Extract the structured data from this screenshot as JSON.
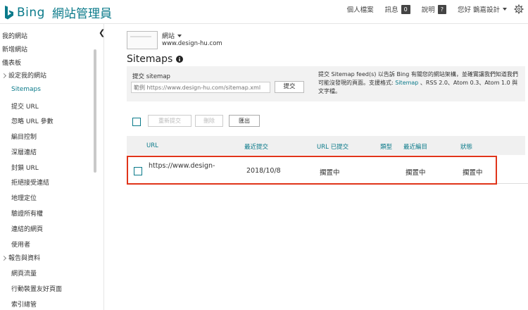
{
  "brand": {
    "name": "Bing",
    "product": "網站管理員",
    "color": "#0a7a8a"
  },
  "top_links": [
    {
      "label": "個人檔案"
    },
    {
      "label": "訊息",
      "badge": "0"
    },
    {
      "label": "說明",
      "badge": "?"
    },
    {
      "label": "您好 鵲嘉設計"
    }
  ],
  "sidebar": {
    "items": [
      {
        "label": "我的網站"
      },
      {
        "label": "新增網站"
      },
      {
        "label": "儀表板"
      },
      {
        "label": "設定我的網站",
        "expandable": true
      },
      {
        "label": "Sitemaps",
        "active": true
      },
      {
        "label": "提交 URL"
      },
      {
        "label": "忽略 URL 參數"
      },
      {
        "label": "編目控制"
      },
      {
        "label": "深層連結"
      },
      {
        "label": "封鎖 URL"
      },
      {
        "label": "拒絕接受連結"
      },
      {
        "label": "地理定位"
      },
      {
        "label": "驗證所有權"
      },
      {
        "label": "連結的網頁"
      },
      {
        "label": "使用者"
      },
      {
        "label": "報告與資料",
        "expandable": true
      },
      {
        "label": "網頁流量"
      },
      {
        "label": "行動裝置友好頁面"
      },
      {
        "label": "索引總管"
      }
    ]
  },
  "site": {
    "name": "網站",
    "url": "www.design-hu.com"
  },
  "page": {
    "title": "Sitemaps"
  },
  "submit": {
    "label": "提交 sitemap",
    "placeholder": "範例 https://www.design-hu.com/sitemap.xml",
    "button": "提交",
    "desc_prefix": "提交 Sitemap feed(s) 以告訴 Bing 有關您的網站架構，並確實讓我們知道我們可能沒發現的頁面。支援格式: ",
    "desc_link": "Sitemap",
    "desc_suffix": " 、RSS 2.0、Atom 0.3、Atom 1.0 與文字檔。"
  },
  "toolbar": {
    "resubmit": "重新提交",
    "delete": "刪除",
    "export": "匯出"
  },
  "table": {
    "headers": [
      "URL",
      "最近提交",
      "URL 已提交",
      "類型",
      "最近編目",
      "狀態"
    ],
    "rows": [
      {
        "url": "https://www.design-",
        "last_submitted": "2018/10/8",
        "urls_submitted": "擱置中",
        "type": "",
        "last_crawled": "擱置中",
        "status": "擱置中"
      }
    ]
  },
  "highlight_color": "#e0341a"
}
